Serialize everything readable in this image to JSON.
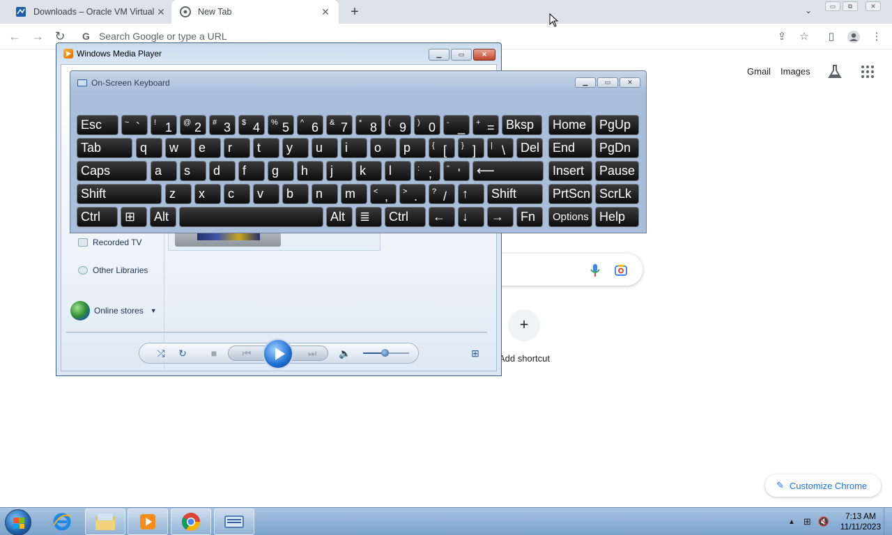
{
  "browser": {
    "tabs": [
      {
        "label": "Downloads – Oracle VM VirtualB",
        "active": false
      },
      {
        "label": "New Tab",
        "active": true
      }
    ],
    "omnibox_placeholder": "Search Google or type a URL",
    "top_links": {
      "gmail": "Gmail",
      "images": "Images"
    },
    "shortcut_add_label": "Add shortcut",
    "customize_label": "Customize Chrome"
  },
  "media_player": {
    "title": "Windows Media Player",
    "library_items": {
      "recorded_tv": "Recorded TV",
      "other_libraries": "Other Libraries"
    },
    "online_stores": "Online stores"
  },
  "osk": {
    "title": "On-Screen Keyboard",
    "rows": [
      [
        {
          "label": "Esc"
        },
        {
          "sup": "~",
          "main": "`"
        },
        {
          "sup": "!",
          "main": "1"
        },
        {
          "sup": "@",
          "main": "2"
        },
        {
          "sup": "#",
          "main": "3"
        },
        {
          "sup": "$",
          "main": "4"
        },
        {
          "sup": "%",
          "main": "5"
        },
        {
          "sup": "^",
          "main": "6"
        },
        {
          "sup": "&",
          "main": "7"
        },
        {
          "sup": "*",
          "main": "8"
        },
        {
          "sup": "(",
          "main": "9"
        },
        {
          "sup": ")",
          "main": "0"
        },
        {
          "sup": "-",
          "main": "_"
        },
        {
          "sup": "+",
          "main": "="
        },
        {
          "label": "Bksp"
        },
        {
          "label": "Home"
        },
        {
          "label": "PgUp"
        }
      ],
      [
        {
          "label": "Tab"
        },
        {
          "label": "q"
        },
        {
          "label": "w"
        },
        {
          "label": "e"
        },
        {
          "label": "r"
        },
        {
          "label": "t"
        },
        {
          "label": "y"
        },
        {
          "label": "u"
        },
        {
          "label": "i"
        },
        {
          "label": "o"
        },
        {
          "label": "p"
        },
        {
          "sup": "{",
          "main": "["
        },
        {
          "sup": "}",
          "main": "]"
        },
        {
          "sup": "|",
          "main": "\\"
        },
        {
          "label": "Del"
        },
        {
          "label": "End"
        },
        {
          "label": "PgDn"
        }
      ],
      [
        {
          "label": "Caps"
        },
        {
          "label": "a"
        },
        {
          "label": "s"
        },
        {
          "label": "d"
        },
        {
          "label": "f"
        },
        {
          "label": "g"
        },
        {
          "label": "h"
        },
        {
          "label": "j"
        },
        {
          "label": "k"
        },
        {
          "label": "l"
        },
        {
          "sup": ":",
          "main": ";"
        },
        {
          "sup": "\"",
          "main": "'"
        },
        {
          "label": "⟵"
        },
        {
          "label": "Insert"
        },
        {
          "label": "Pause"
        }
      ],
      [
        {
          "label": "Shift"
        },
        {
          "label": "z"
        },
        {
          "label": "x"
        },
        {
          "label": "c"
        },
        {
          "label": "v"
        },
        {
          "label": "b"
        },
        {
          "label": "n"
        },
        {
          "label": "m"
        },
        {
          "sup": "<",
          "main": ","
        },
        {
          "sup": ">",
          "main": "."
        },
        {
          "sup": "?",
          "main": "/"
        },
        {
          "label": "↑"
        },
        {
          "label": "Shift"
        },
        {
          "label": "PrtScn"
        },
        {
          "label": "ScrLk"
        }
      ],
      [
        {
          "label": "Ctrl"
        },
        {
          "label": "⊞"
        },
        {
          "label": "Alt"
        },
        {
          "label": ""
        },
        {
          "label": "Alt"
        },
        {
          "label": "≣"
        },
        {
          "label": "Ctrl"
        },
        {
          "label": "←"
        },
        {
          "label": "↓"
        },
        {
          "label": "→"
        },
        {
          "label": "Fn"
        },
        {
          "label": "Options"
        },
        {
          "label": "Help"
        }
      ]
    ]
  },
  "taskbar": {
    "clock_time": "7:13 AM",
    "clock_date": "11/11/2023"
  },
  "colors": {
    "chrome_tabstrip": "#dee1e6",
    "link_blue": "#1a73e8",
    "osk_key": "#0d0d0d",
    "taskbar": "#8fb1d6"
  }
}
